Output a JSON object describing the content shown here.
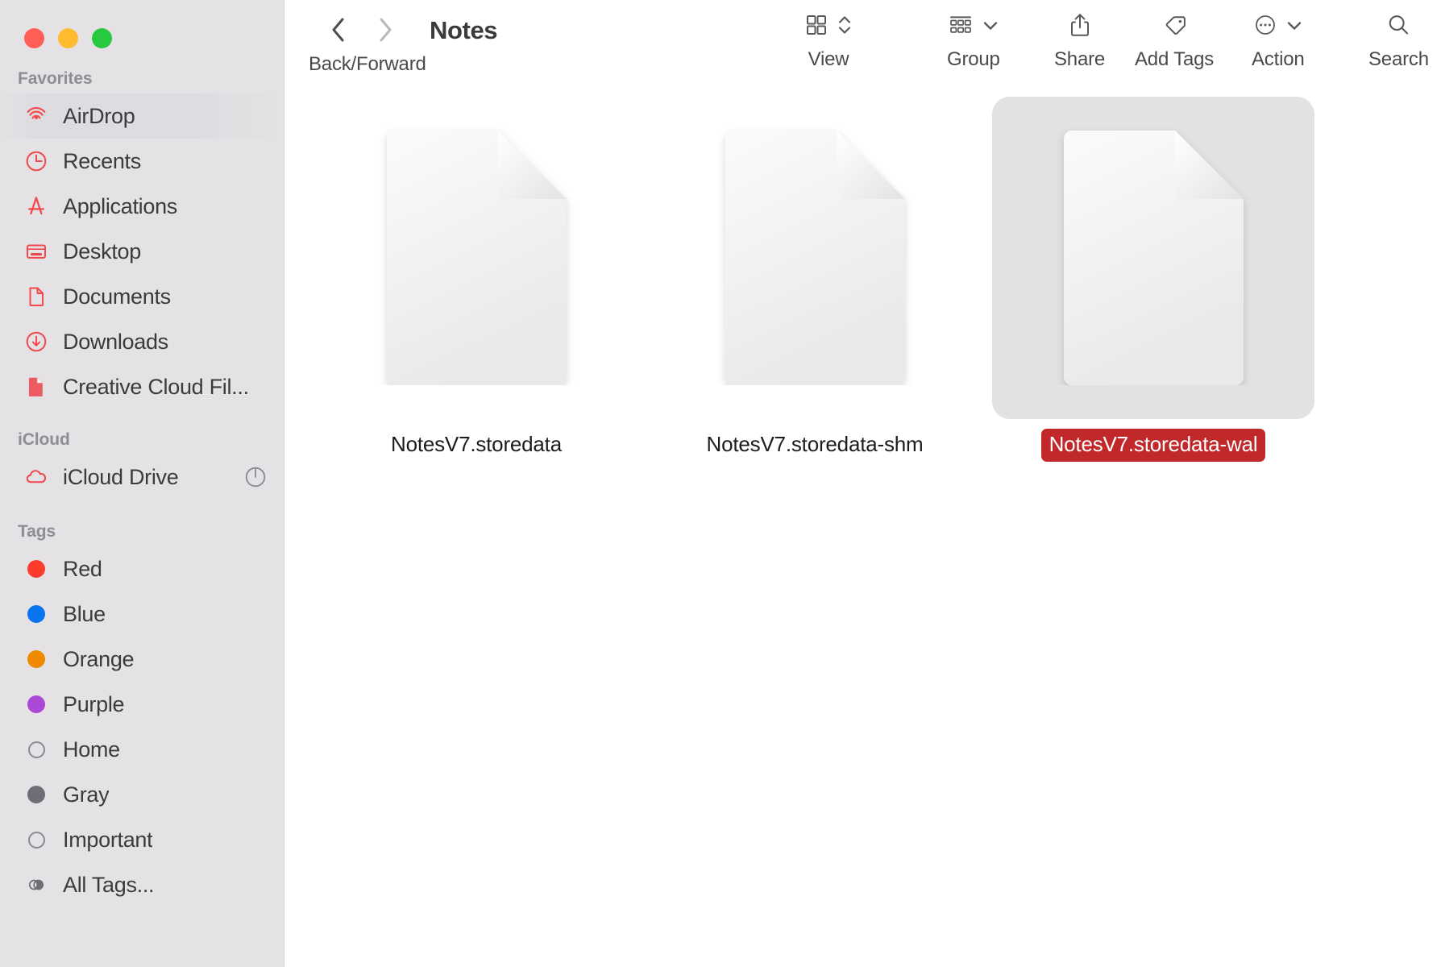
{
  "window": {
    "title": "Notes",
    "traffic_lights": [
      {
        "name": "close",
        "color": "#ff5f57"
      },
      {
        "name": "minimize",
        "color": "#febc2e"
      },
      {
        "name": "zoom",
        "color": "#28c840"
      }
    ]
  },
  "toolbar": {
    "nav_label": "Back/Forward",
    "back_icon": "chevron-left-icon",
    "forward_icon": "chevron-right-icon",
    "items": [
      {
        "label": "View",
        "icon": "grid-view-icon",
        "chevron": "chevron-updown-icon"
      },
      {
        "label": "Group",
        "icon": "group-list-icon",
        "chevron": "chevron-down-icon"
      },
      {
        "label": "Share",
        "icon": "share-icon",
        "chevron": ""
      },
      {
        "label": "Add Tags",
        "icon": "tag-icon",
        "chevron": ""
      },
      {
        "label": "Action",
        "icon": "ellipsis-circle-icon",
        "chevron": "chevron-down-icon"
      },
      {
        "label": "Search",
        "icon": "search-icon",
        "chevron": ""
      }
    ]
  },
  "sidebar": {
    "sections": [
      {
        "title": "Favorites",
        "items": [
          {
            "label": "AirDrop",
            "icon": "airdrop-icon",
            "icon_color": "#f2484b",
            "highlighted": true
          },
          {
            "label": "Recents",
            "icon": "clock-icon",
            "icon_color": "#f2484b"
          },
          {
            "label": "Applications",
            "icon": "applications-icon",
            "icon_color": "#f2484b"
          },
          {
            "label": "Desktop",
            "icon": "desktop-icon",
            "icon_color": "#f2484b"
          },
          {
            "label": "Documents",
            "icon": "document-icon",
            "icon_color": "#f2484b"
          },
          {
            "label": "Downloads",
            "icon": "download-circle-icon",
            "icon_color": "#f2484b"
          },
          {
            "label": "Creative Cloud Fil...",
            "icon": "creative-cloud-files-icon",
            "icon_color": "#ec5a62"
          }
        ]
      },
      {
        "title": "iCloud",
        "items": [
          {
            "label": "iCloud Drive",
            "icon": "cloud-icon",
            "icon_color": "#f2484b",
            "trailing_icon": "sync-progress-icon"
          }
        ]
      },
      {
        "title": "Tags",
        "items": [
          {
            "label": "Red",
            "icon": "tag-dot-icon",
            "icon_color": "#fc3b2d"
          },
          {
            "label": "Blue",
            "icon": "tag-dot-icon",
            "icon_color": "#0a74ef"
          },
          {
            "label": "Orange",
            "icon": "tag-dot-icon",
            "icon_color": "#ee8900"
          },
          {
            "label": "Purple",
            "icon": "tag-dot-icon",
            "icon_color": "#ab48d6"
          },
          {
            "label": "Home",
            "icon": "tag-ring-icon",
            "icon_color": "#8a8a8e"
          },
          {
            "label": "Gray",
            "icon": "tag-dot-icon",
            "icon_color": "#6e6e76"
          },
          {
            "label": "Important",
            "icon": "tag-ring-icon",
            "icon_color": "#8a8a8e"
          },
          {
            "label": "All Tags...",
            "icon": "all-tags-icon",
            "icon_color": "#6e6e76"
          }
        ]
      }
    ]
  },
  "files": [
    {
      "name": "NotesV7.storedata",
      "icon": "blank-document-icon",
      "selected": false
    },
    {
      "name": "NotesV7.storedata-shm",
      "icon": "blank-document-icon",
      "selected": false
    },
    {
      "name": "NotesV7.storedata-wal",
      "icon": "blank-document-icon",
      "selected": true
    }
  ],
  "colors": {
    "sidebar_bg": "#e4e2e4",
    "selection_label_bg": "#c0282a",
    "accent_red": "#f2484b"
  }
}
